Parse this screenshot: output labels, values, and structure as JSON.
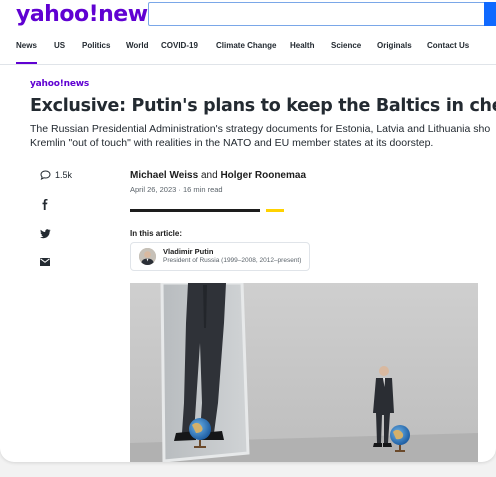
{
  "header": {
    "logo": "yahoo!news",
    "search_placeholder": ""
  },
  "nav": {
    "items": [
      "News",
      "US",
      "Politics",
      "World",
      "COVID-19",
      "Climate Change",
      "Health",
      "Science",
      "Originals",
      "Contact Us"
    ]
  },
  "article": {
    "source": "yahoo!news",
    "headline": "Exclusive: Putin's plans to keep the Baltics in check",
    "summary_line1": "The Russian Presidential Administration's strategy documents for Estonia, Latvia and Lithuania sho",
    "summary_line2": "Kremlin \"out of touch\" with realities in the NATO and EU member states at its doorstep.",
    "comment_count": "1.5k",
    "author1": "Michael Weiss",
    "author_and": "and",
    "author2": "Holger Roonemaa",
    "date": "April 26, 2023",
    "read_time": "16 min read",
    "in_this_article": "In this article:",
    "person_name": "Vladimir Putin",
    "person_role": "President of Russia (1999–2008, 2012–present)"
  },
  "colors": {
    "brand": "#6001d2",
    "accent_bar": "#ffd200",
    "search_button": "#0f69ff"
  },
  "icons": [
    "comment-icon",
    "facebook-icon",
    "twitter-icon",
    "mail-icon"
  ]
}
